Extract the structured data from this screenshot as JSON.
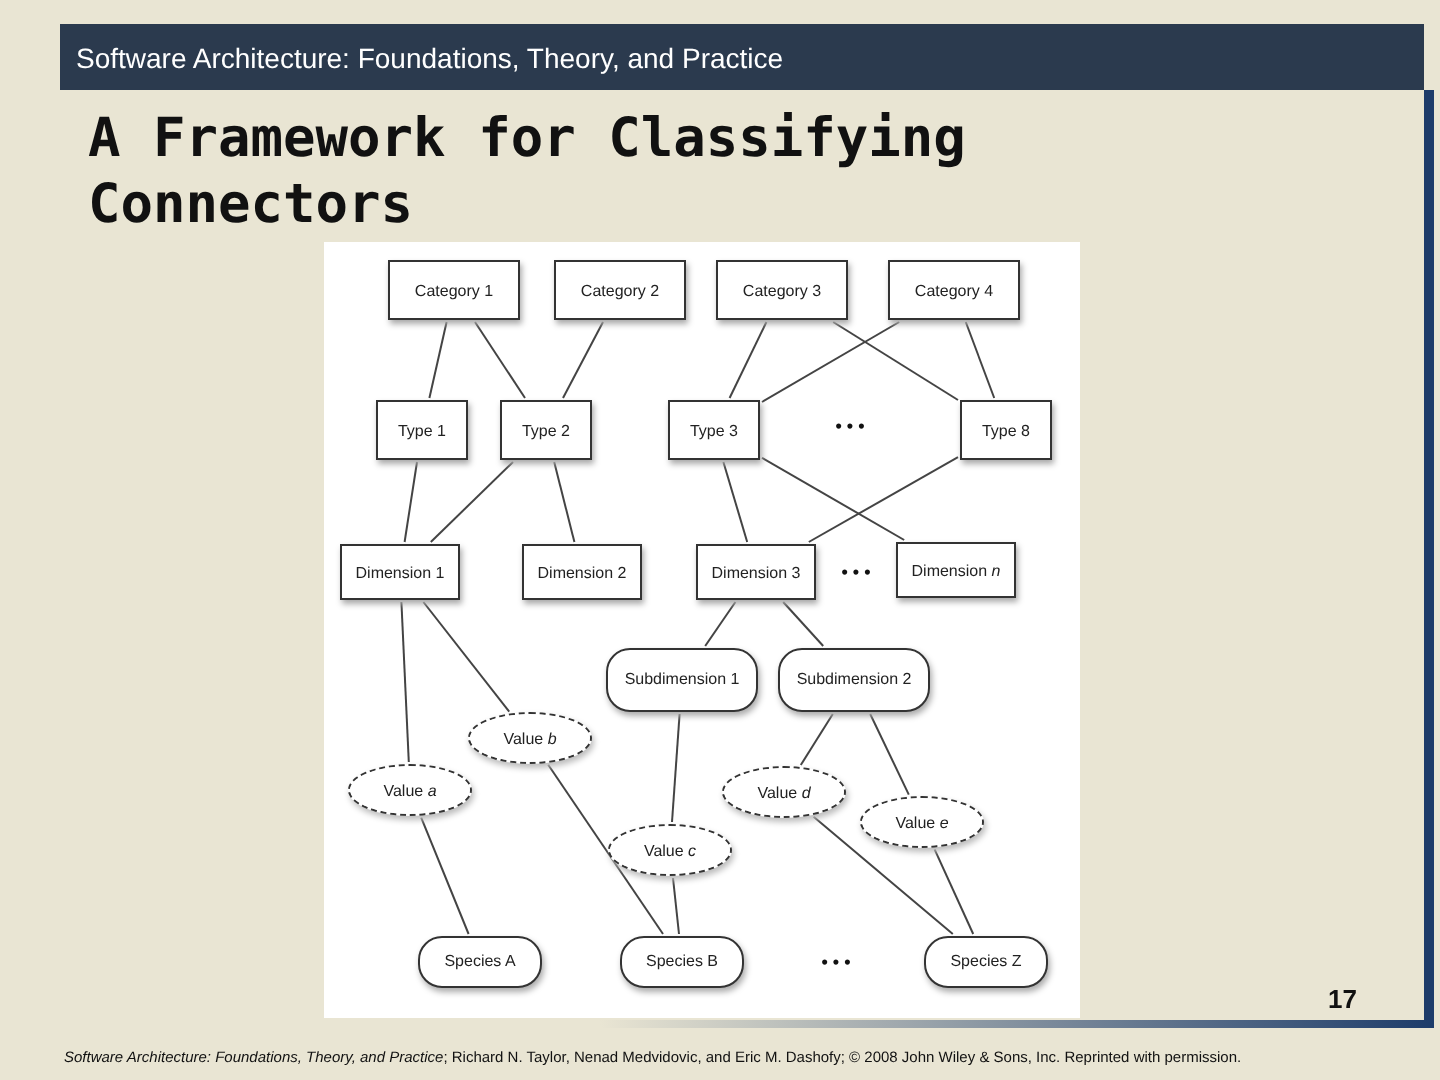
{
  "header": {
    "title": "Software Architecture: Foundations, Theory, and Practice"
  },
  "slide": {
    "title": "A Framework for Classifying Connectors",
    "page_number": "17"
  },
  "diagram": {
    "nodes": [
      {
        "label": "Category 1",
        "kind": "box"
      },
      {
        "label": "Category 2",
        "kind": "box"
      },
      {
        "label": "Category 3",
        "kind": "box"
      },
      {
        "label": "Category 4",
        "kind": "box"
      },
      {
        "label": "Type 1",
        "kind": "box"
      },
      {
        "label": "Type 2",
        "kind": "box"
      },
      {
        "label": "Type 3",
        "kind": "box"
      },
      {
        "label": "• • •",
        "kind": "ellipsis"
      },
      {
        "label": "Type 8",
        "kind": "box"
      },
      {
        "label": "Dimension 1",
        "kind": "box"
      },
      {
        "label": "Dimension 2",
        "kind": "box"
      },
      {
        "label": "Dimension 3",
        "kind": "box"
      },
      {
        "label": "• • •",
        "kind": "ellipsis"
      },
      {
        "label": "Dimension *n*",
        "kind": "box"
      },
      {
        "label": "Subdimension 1",
        "kind": "rounded"
      },
      {
        "label": "Subdimension 2",
        "kind": "rounded"
      },
      {
        "label": "Value *b*",
        "kind": "value"
      },
      {
        "label": "Value *a*",
        "kind": "value"
      },
      {
        "label": "Value *c*",
        "kind": "value"
      },
      {
        "label": "Value *d*",
        "kind": "value"
      },
      {
        "label": "Value *e*",
        "kind": "value"
      },
      {
        "label": "Species A",
        "kind": "rounded"
      },
      {
        "label": "Species B",
        "kind": "rounded"
      },
      {
        "label": "• • •",
        "kind": "ellipsis"
      },
      {
        "label": "Species Z",
        "kind": "rounded"
      }
    ]
  },
  "footer": {
    "citation": "*Software Architecture: Foundations, Theory, and Practice*; Richard N. Taylor, Nenad Medvidovic, and Eric M. Dashofy; © 2008 John Wiley & Sons, Inc. Reprinted with permission."
  }
}
